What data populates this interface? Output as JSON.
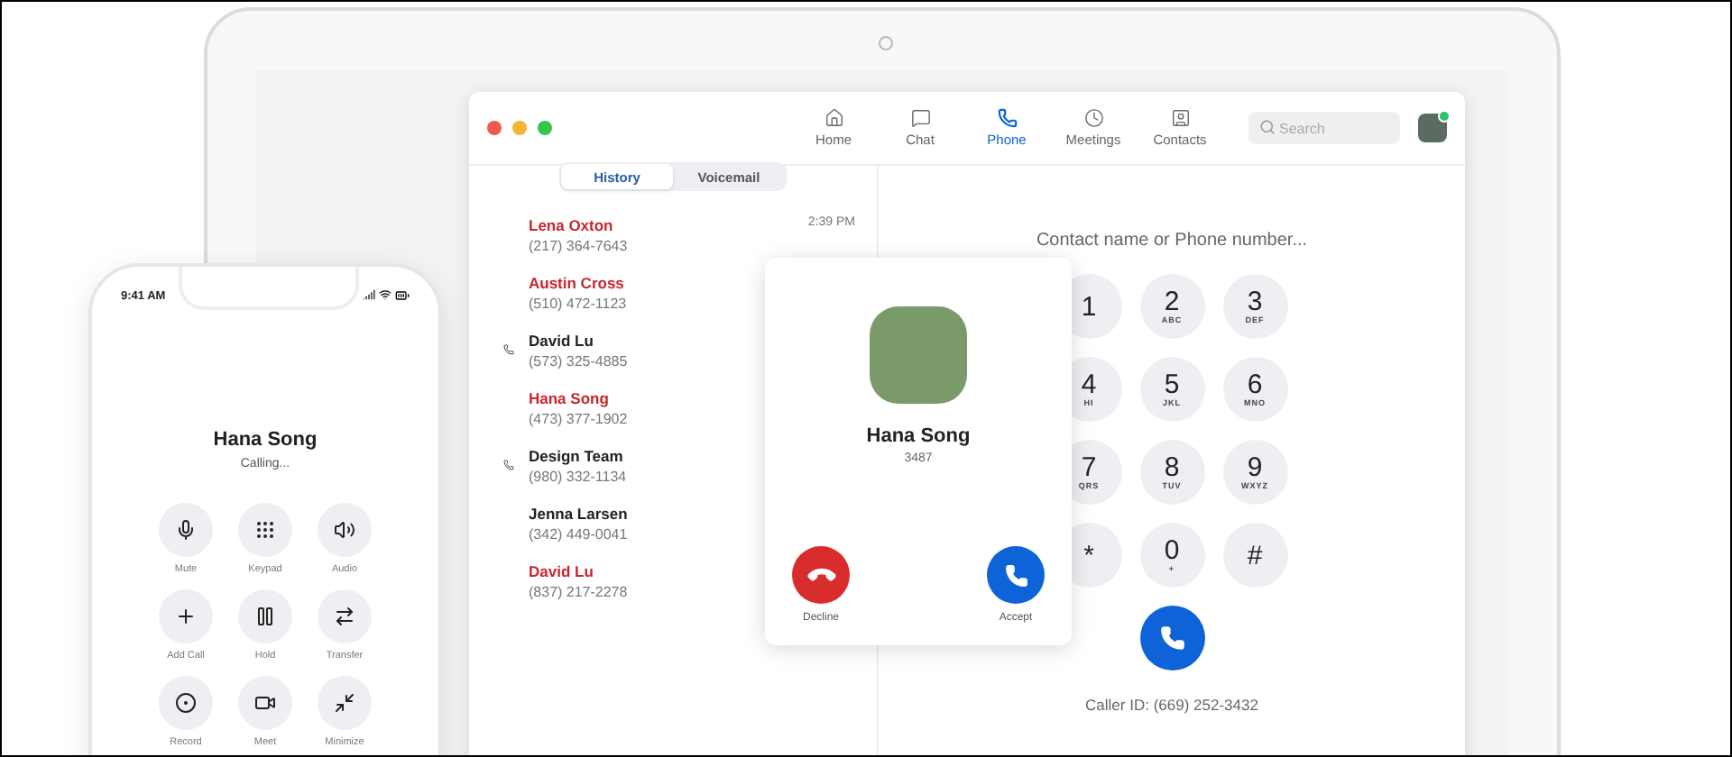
{
  "app": {
    "nav": [
      {
        "kind": "home",
        "label": "Home",
        "selected": false
      },
      {
        "kind": "chat",
        "label": "Chat",
        "selected": false
      },
      {
        "kind": "phone",
        "label": "Phone",
        "selected": true
      },
      {
        "kind": "meetings",
        "label": "Meetings",
        "selected": false
      },
      {
        "kind": "contacts",
        "label": "Contacts",
        "selected": false
      }
    ],
    "search": {
      "placeholder": "Search"
    },
    "profile": {
      "online": true
    }
  },
  "history": {
    "segments": [
      {
        "label": "History",
        "selected": true
      },
      {
        "label": "Voicemail",
        "selected": false
      }
    ],
    "calls": [
      {
        "name": "Lena Oxton",
        "number": "(217) 364-7643",
        "missed": true,
        "outgoing": false,
        "time": "2:39 PM"
      },
      {
        "name": "Austin Cross",
        "number": "(510) 472-1123",
        "missed": true,
        "outgoing": false
      },
      {
        "name": "David Lu",
        "number": "(573) 325-4885",
        "missed": false,
        "outgoing": true
      },
      {
        "name": "Hana Song",
        "number": "(473) 377-1902",
        "missed": true,
        "outgoing": false
      },
      {
        "name": "Design Team",
        "number": "(980) 332-1134",
        "missed": false,
        "outgoing": true
      },
      {
        "name": "Jenna Larsen",
        "number": "(342) 449-0041",
        "missed": false,
        "outgoing": false
      },
      {
        "name": "David Lu",
        "number": "(837) 217-2278",
        "missed": true,
        "outgoing": false
      }
    ]
  },
  "dialer": {
    "placeholder": "Contact name or Phone number...",
    "keys": [
      {
        "digit": "1"
      },
      {
        "digit": "2",
        "letters": "ABC"
      },
      {
        "digit": "3",
        "letters": "DEF"
      },
      {
        "digit": "4",
        "letters": "HI"
      },
      {
        "digit": "5",
        "letters": "JKL"
      },
      {
        "digit": "6",
        "letters": "MNO"
      },
      {
        "digit": "7",
        "letters": "QRS"
      },
      {
        "digit": "8",
        "letters": "TUV"
      },
      {
        "digit": "9",
        "letters": "WXYZ"
      },
      {
        "digit": "*"
      },
      {
        "digit": "0",
        "letters": "+"
      },
      {
        "digit": "#"
      }
    ],
    "caller_id": "Caller ID: (669) 252-3432"
  },
  "incoming_call": {
    "name": "Hana Song",
    "extension": "3487",
    "buttons": [
      {
        "kind": "decline",
        "label": "Decline"
      },
      {
        "kind": "accept",
        "label": "Accept"
      }
    ]
  },
  "mobile": {
    "time": "9:41 AM",
    "name": "Hana Song",
    "status": "Calling...",
    "actions": [
      {
        "kind": "mute",
        "label": "Mute"
      },
      {
        "kind": "keypad",
        "label": "Keypad"
      },
      {
        "kind": "audio",
        "label": "Audio"
      },
      {
        "kind": "add",
        "label": "Add Call"
      },
      {
        "kind": "hold",
        "label": "Hold"
      },
      {
        "kind": "transfer",
        "label": "Transfer"
      },
      {
        "kind": "record",
        "label": "Record"
      },
      {
        "kind": "meet",
        "label": "Meet"
      },
      {
        "kind": "minimize",
        "label": "Minimize"
      }
    ]
  }
}
